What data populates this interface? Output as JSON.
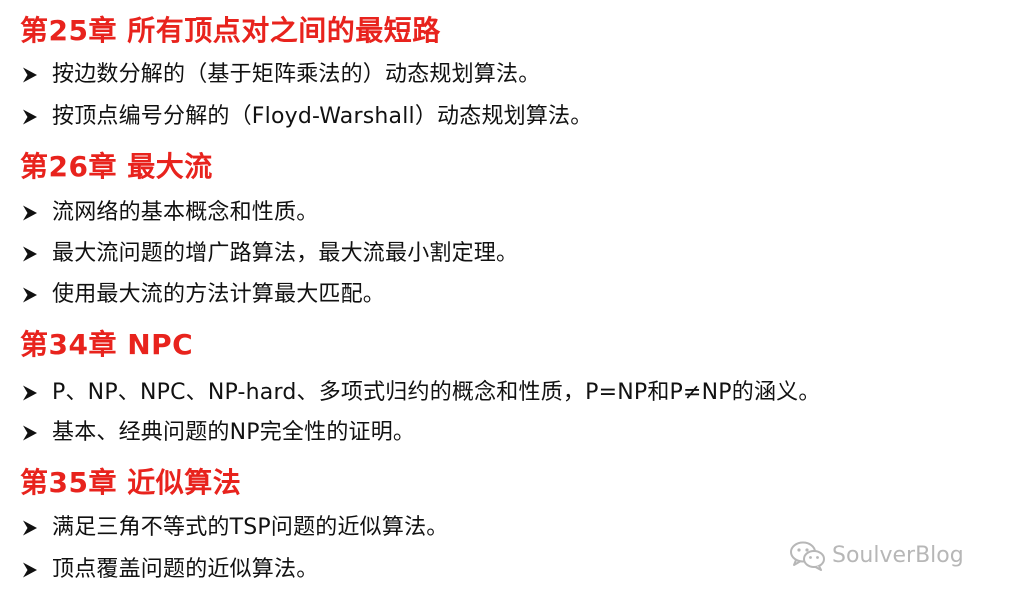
{
  "theme": {
    "heading_color": "#e8231d",
    "text_color": "#111111",
    "watermark_color": "#b7b7b7"
  },
  "sections": [
    {
      "title": "第25章 所有顶点对之间的最短路",
      "items": [
        "按边数分解的（基于矩阵乘法的）动态规划算法。",
        "按顶点编号分解的（Floyd-Warshall）动态规划算法。"
      ]
    },
    {
      "title": "第26章 最大流",
      "items": [
        "流网络的基本概念和性质。",
        "最大流问题的增广路算法，最大流最小割定理。",
        "使用最大流的方法计算最大匹配。"
      ]
    },
    {
      "title": "第34章 NPC",
      "items": [
        "P、NP、NPC、NP-hard、多项式归约的概念和性质，P=NP和P≠NP的涵义。",
        "基本、经典问题的NP完全性的证明。"
      ]
    },
    {
      "title": "第35章 近似算法",
      "items": [
        "满足三角不等式的TSP问题的近似算法。",
        "顶点覆盖问题的近似算法。"
      ]
    }
  ],
  "bullet_icon": "arrowhead-bullet-icon",
  "watermark": {
    "icon": "wechat-icon",
    "text": "SoulverBlog"
  }
}
